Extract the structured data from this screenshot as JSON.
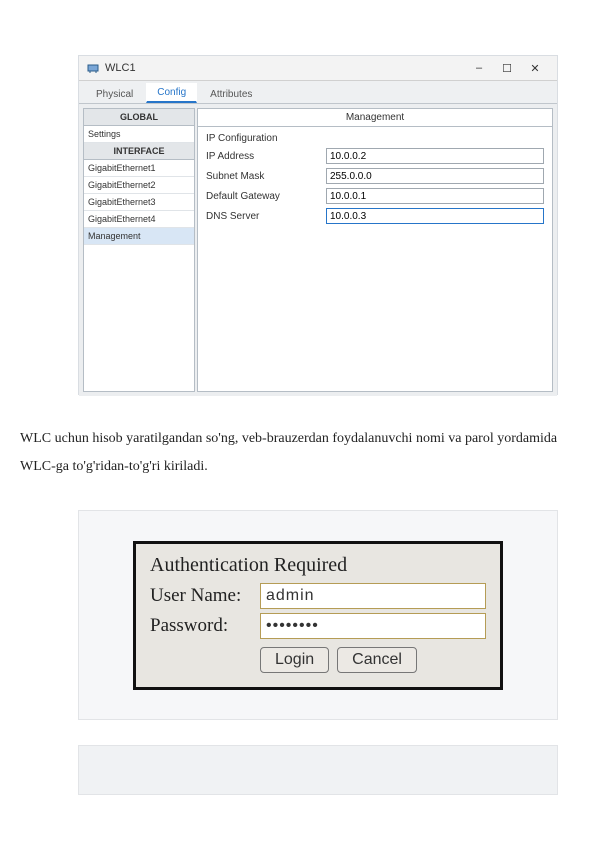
{
  "wlc_window": {
    "title": "WLC1",
    "controls": {
      "minimize": "–",
      "maximize": "☐",
      "close": "✕"
    },
    "tabs": {
      "physical": "Physical",
      "config": "Config",
      "attributes": "Attributes"
    },
    "sidebar": {
      "global_header": "GLOBAL",
      "settings": "Settings",
      "interface_header": "INTERFACE",
      "ge1": "GigabitEthernet1",
      "ge2": "GigabitEthernet2",
      "ge3": "GigabitEthernet3",
      "ge4": "GigabitEthernet4",
      "management": "Management"
    },
    "panel": {
      "title": "Management",
      "section": "IP Configuration",
      "ip_address_label": "IP Address",
      "ip_address_value": "10.0.0.2",
      "subnet_label": "Subnet Mask",
      "subnet_value": "255.0.0.0",
      "gateway_label": "Default Gateway",
      "gateway_value": "10.0.0.1",
      "dns_label": "DNS Server",
      "dns_value": "10.0.0.3"
    }
  },
  "paragraph": "WLC uchun hisob yaratilgandan so'ng, veb-brauzerdan foydalanuvchi nomi va parol yordamida WLC-ga to'g'ridan-to'g'ri kiriladi.",
  "auth": {
    "title": "Authentication Required",
    "user_label": "User Name:",
    "user_value": "admin",
    "pass_label": "Password:",
    "pass_value": "••••••••",
    "login": "Login",
    "cancel": "Cancel"
  }
}
